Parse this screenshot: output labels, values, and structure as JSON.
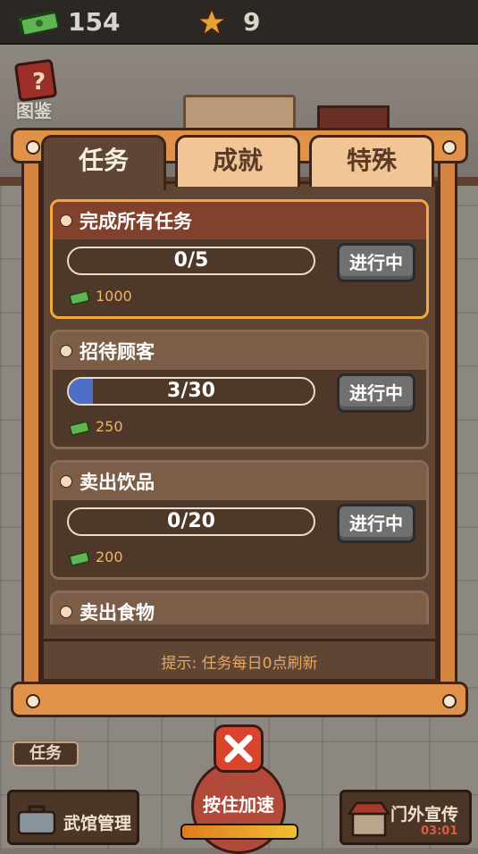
{
  "topbar": {
    "cash": "154",
    "stars": "9"
  },
  "guide": {
    "label": "图鉴"
  },
  "tabs": [
    {
      "label": "任务",
      "active": true
    },
    {
      "label": "成就",
      "active": false
    },
    {
      "label": "特殊",
      "active": false
    }
  ],
  "tasks": [
    {
      "title": "完成所有任务",
      "progress_text": "0/5",
      "progress": 0.0,
      "status": "进行中",
      "reward": "1000",
      "highlight": true
    },
    {
      "title": "招待顾客",
      "progress_text": "3/30",
      "progress": 0.1,
      "status": "进行中",
      "reward": "250",
      "highlight": false
    },
    {
      "title": "卖出饮品",
      "progress_text": "0/20",
      "progress": 0.0,
      "status": "进行中",
      "reward": "200",
      "highlight": false
    },
    {
      "title": "卖出食物",
      "progress_text": "",
      "progress": 0.0,
      "status": "",
      "reward": "",
      "highlight": false
    }
  ],
  "hint": "提示: 任务每日0点刷新",
  "bottom": {
    "task_shortcut": "任务",
    "speed_label": "按住加速",
    "left_button": "武馆管理",
    "right_button": "门外宣传",
    "timer": "03:01"
  },
  "colors": {
    "accent": "#e0924a",
    "status_text": "#f2b463",
    "progress_fill": "#4f6fc7"
  }
}
